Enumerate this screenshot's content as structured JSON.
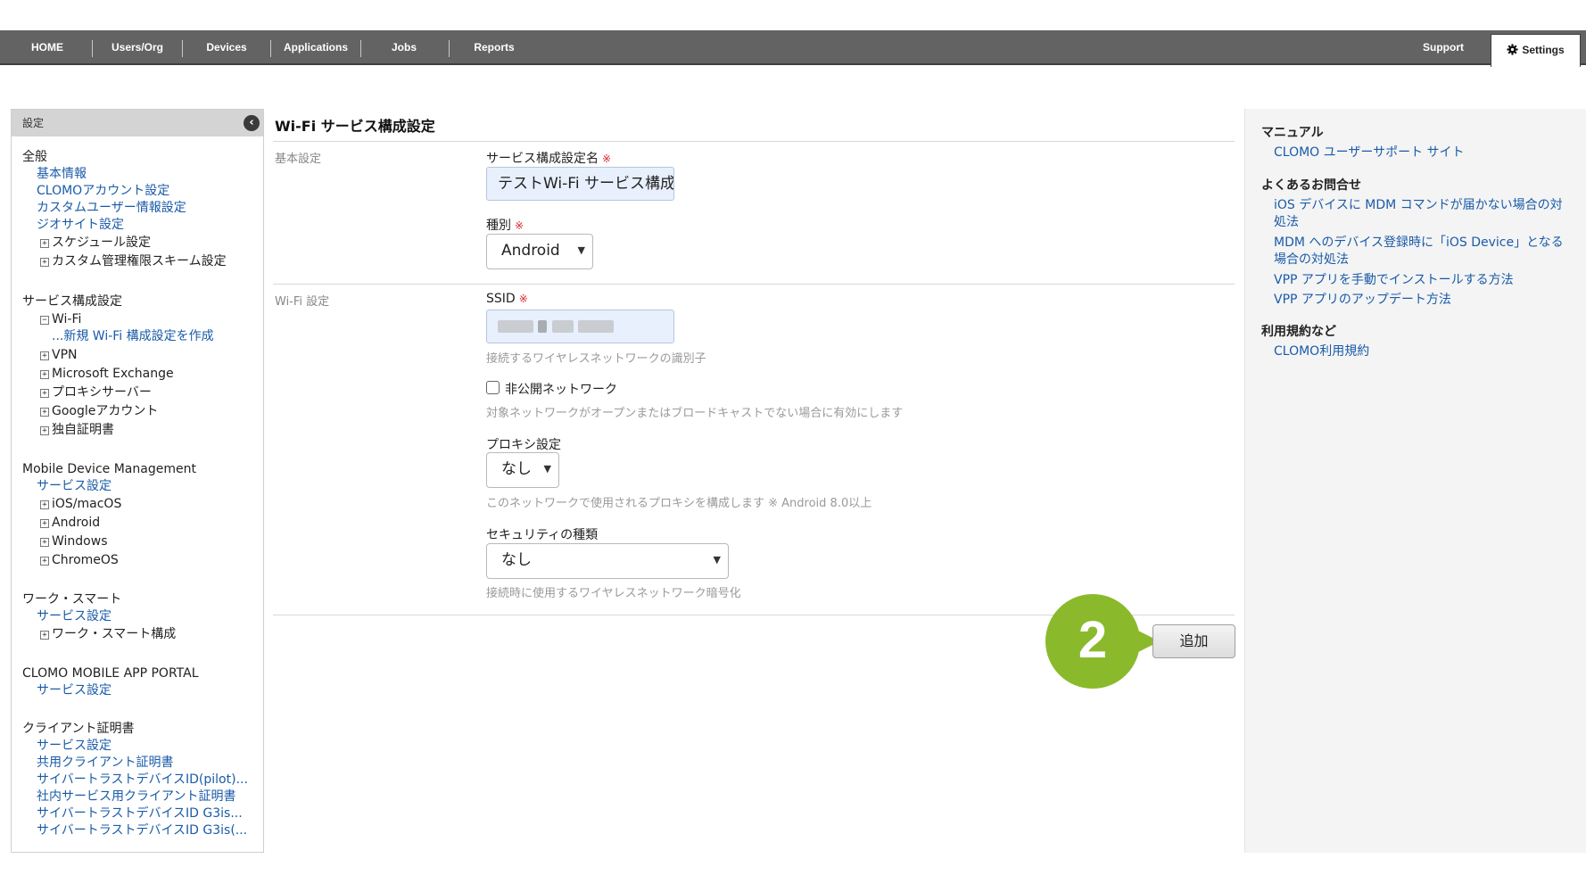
{
  "nav": {
    "items": [
      "HOME",
      "Users/Org",
      "Devices",
      "Applications",
      "Jobs",
      "Reports"
    ],
    "support": "Support",
    "settings": "Settings"
  },
  "sidebar": {
    "header": "設定",
    "general": {
      "title": "全般",
      "links": [
        "基本情報",
        "CLOMOアカウント設定",
        "カスタムユーザー情報設定",
        "ジオサイト設定"
      ],
      "expandables": [
        "スケジュール設定",
        "カスタム管理権限スキーム設定"
      ]
    },
    "service": {
      "title": "サービス構成設定",
      "wifi": "Wi-Fi",
      "wifi_new": "...新規 Wi-Fi 構成設定を作成",
      "expandables": [
        "VPN",
        "Microsoft Exchange",
        "プロキシサーバー",
        "Googleアカウント",
        "独自証明書"
      ]
    },
    "mdm": {
      "title": "Mobile Device Management",
      "link": "サービス設定",
      "expandables": [
        "iOS/macOS",
        "Android",
        "Windows",
        "ChromeOS"
      ]
    },
    "work": {
      "title": "ワーク・スマート",
      "link": "サービス設定",
      "expandables": [
        "ワーク・スマート構成"
      ]
    },
    "portal": {
      "title": "CLOMO MOBILE APP PORTAL",
      "link": "サービス設定"
    },
    "client_cert": {
      "title": "クライアント証明書",
      "links": [
        "サービス設定",
        "共用クライアント証明書",
        "サイバートラストデバイスID(pilot)...",
        "社内サービス用クライアント証明書",
        "サイバートラストデバイスID G3is...",
        "サイバートラストデバイスID G3is(..."
      ]
    }
  },
  "main": {
    "title": "Wi-Fi サービス構成設定",
    "basic_section": "基本設定",
    "wifi_section": "Wi-Fi 設定",
    "name_label": "サービス構成設定名",
    "required_mark": "※",
    "name_value": "テストWi-Fi サービス構成",
    "type_label": "種別",
    "type_value": "Android",
    "ssid_label": "SSID",
    "ssid_hint": "接続するワイヤレスネットワークの識別子",
    "hidden_label": "非公開ネットワーク",
    "hidden_checked": false,
    "hidden_hint": "対象ネットワークがオープンまたはブロードキャストでない場合に有効にします",
    "proxy_label": "プロキシ設定",
    "proxy_value": "なし",
    "proxy_hint": "このネットワークで使用されるプロキシを構成します ※ Android 8.0以上",
    "security_label": "セキュリティの種類",
    "security_value": "なし",
    "security_hint": "接続時に使用するワイヤレスネットワーク暗号化",
    "add_button": "追加",
    "step_number": "2",
    "step_color": "#8aba2c"
  },
  "help": {
    "manual_title": "マニュアル",
    "manual_link": "CLOMO ユーザーサポート サイト",
    "faq_title": "よくあるお問合せ",
    "faq_links": [
      "iOS デバイスに MDM コマンドが届かない場合の対処法",
      "MDM へのデバイス登録時に「iOS Device」となる場合の対処法",
      "VPP アプリを手動でインストールする方法",
      "VPP アプリのアップデート方法"
    ],
    "terms_title": "利用規約など",
    "terms_link": "CLOMO利用規約"
  }
}
